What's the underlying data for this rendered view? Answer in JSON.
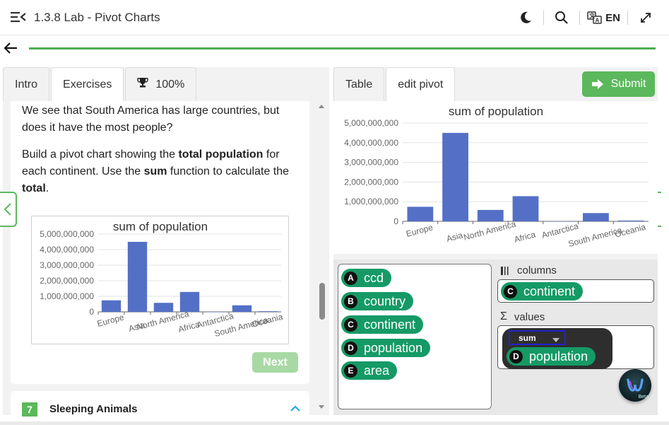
{
  "header": {
    "title": "1.3.8 Lab - Pivot Charts",
    "language": "EN"
  },
  "progress": {
    "percent": 100
  },
  "left": {
    "tabs": [
      {
        "label": "Intro"
      },
      {
        "label": "Exercises"
      },
      {
        "label": "100%"
      }
    ],
    "paragraph1": "We see that South America has large countries, but does it have the most people?",
    "paragraph2": {
      "t1": "Build a pivot chart showing the ",
      "b1": "total population",
      "t2": " for each continent. Use the ",
      "b2": "sum",
      "t3": " function to calculate the ",
      "b3": "total",
      "t4": "."
    },
    "next_label": "Next",
    "next_exercise": {
      "number": "7",
      "title": "Sleeping Animals"
    }
  },
  "right": {
    "tabs": [
      {
        "label": "Table"
      },
      {
        "label": "edit pivot"
      }
    ],
    "submit_label": "Submit",
    "fields": [
      {
        "letter": "A",
        "name": "ccd"
      },
      {
        "letter": "B",
        "name": "country"
      },
      {
        "letter": "C",
        "name": "continent"
      },
      {
        "letter": "D",
        "name": "population"
      },
      {
        "letter": "E",
        "name": "area"
      }
    ],
    "columns_label": "columns",
    "columns_field": {
      "letter": "C",
      "name": "continent"
    },
    "values_label": "values",
    "aggregate": "sum",
    "values_field": {
      "letter": "D",
      "name": "population"
    }
  },
  "colors": {
    "accent_green": "#5cb85c",
    "pill_green": "#159a66",
    "bar_blue": "#5470c6"
  },
  "chart_data": [
    {
      "type": "bar",
      "title": "sum of population",
      "categories": [
        "Europe",
        "Asia",
        "North America",
        "Africa",
        "Antarctica",
        "South America",
        "Oceania"
      ],
      "values": [
        740000000,
        4500000000,
        580000000,
        1280000000,
        0,
        420000000,
        40000000
      ],
      "yticks": [
        "0",
        "1,000,000,000",
        "2,000,000,000",
        "3,000,000,000",
        "4,000,000,000",
        "5,000,000,000"
      ],
      "ylim": [
        0,
        5000000000
      ],
      "xlabel": "",
      "ylabel": "",
      "grid": true
    },
    {
      "type": "bar",
      "title": "sum of population",
      "categories": [
        "Europe",
        "Asia",
        "North America",
        "Africa",
        "Antarctica",
        "South America",
        "Oceania"
      ],
      "values": [
        740000000,
        4500000000,
        580000000,
        1280000000,
        0,
        420000000,
        40000000
      ],
      "yticks": [
        "0",
        "1,000,000,000",
        "2,000,000,000",
        "3,000,000,000",
        "4,000,000,000",
        "5,000,000,000"
      ],
      "ylim": [
        0,
        5000000000
      ],
      "xlabel": "",
      "ylabel": "",
      "grid": true
    }
  ]
}
